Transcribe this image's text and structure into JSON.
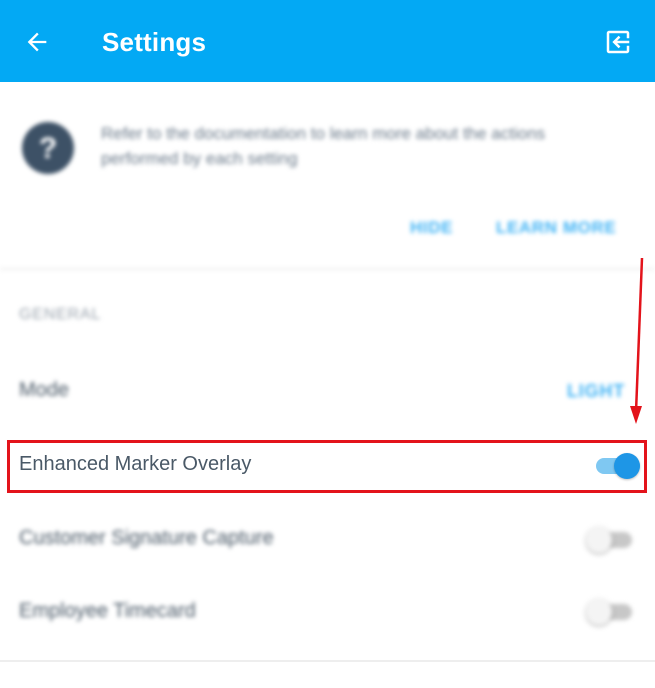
{
  "appbar": {
    "title": "Settings",
    "back_icon": "arrow-left-icon",
    "logout_icon": "logout-icon",
    "background_color": "#03a9f4"
  },
  "help_card": {
    "icon": "help-circle-icon",
    "text": "Refer to the documentation to learn more about the actions performed by each setting",
    "hide_label": "HIDE",
    "learn_more_label": "LEARN MORE"
  },
  "general": {
    "section_label": "GENERAL",
    "mode_label": "Mode",
    "mode_value": "LIGHT"
  },
  "settings": {
    "enhanced_marker_overlay": {
      "label": "Enhanced Marker Overlay",
      "enabled": true
    },
    "customer_signature_capture": {
      "label": "Customer Signature Capture",
      "enabled": false
    },
    "employee_timecard": {
      "label": "Employee Timecard",
      "enabled": false
    }
  },
  "annotation": {
    "highlight_color": "#e3131b"
  }
}
